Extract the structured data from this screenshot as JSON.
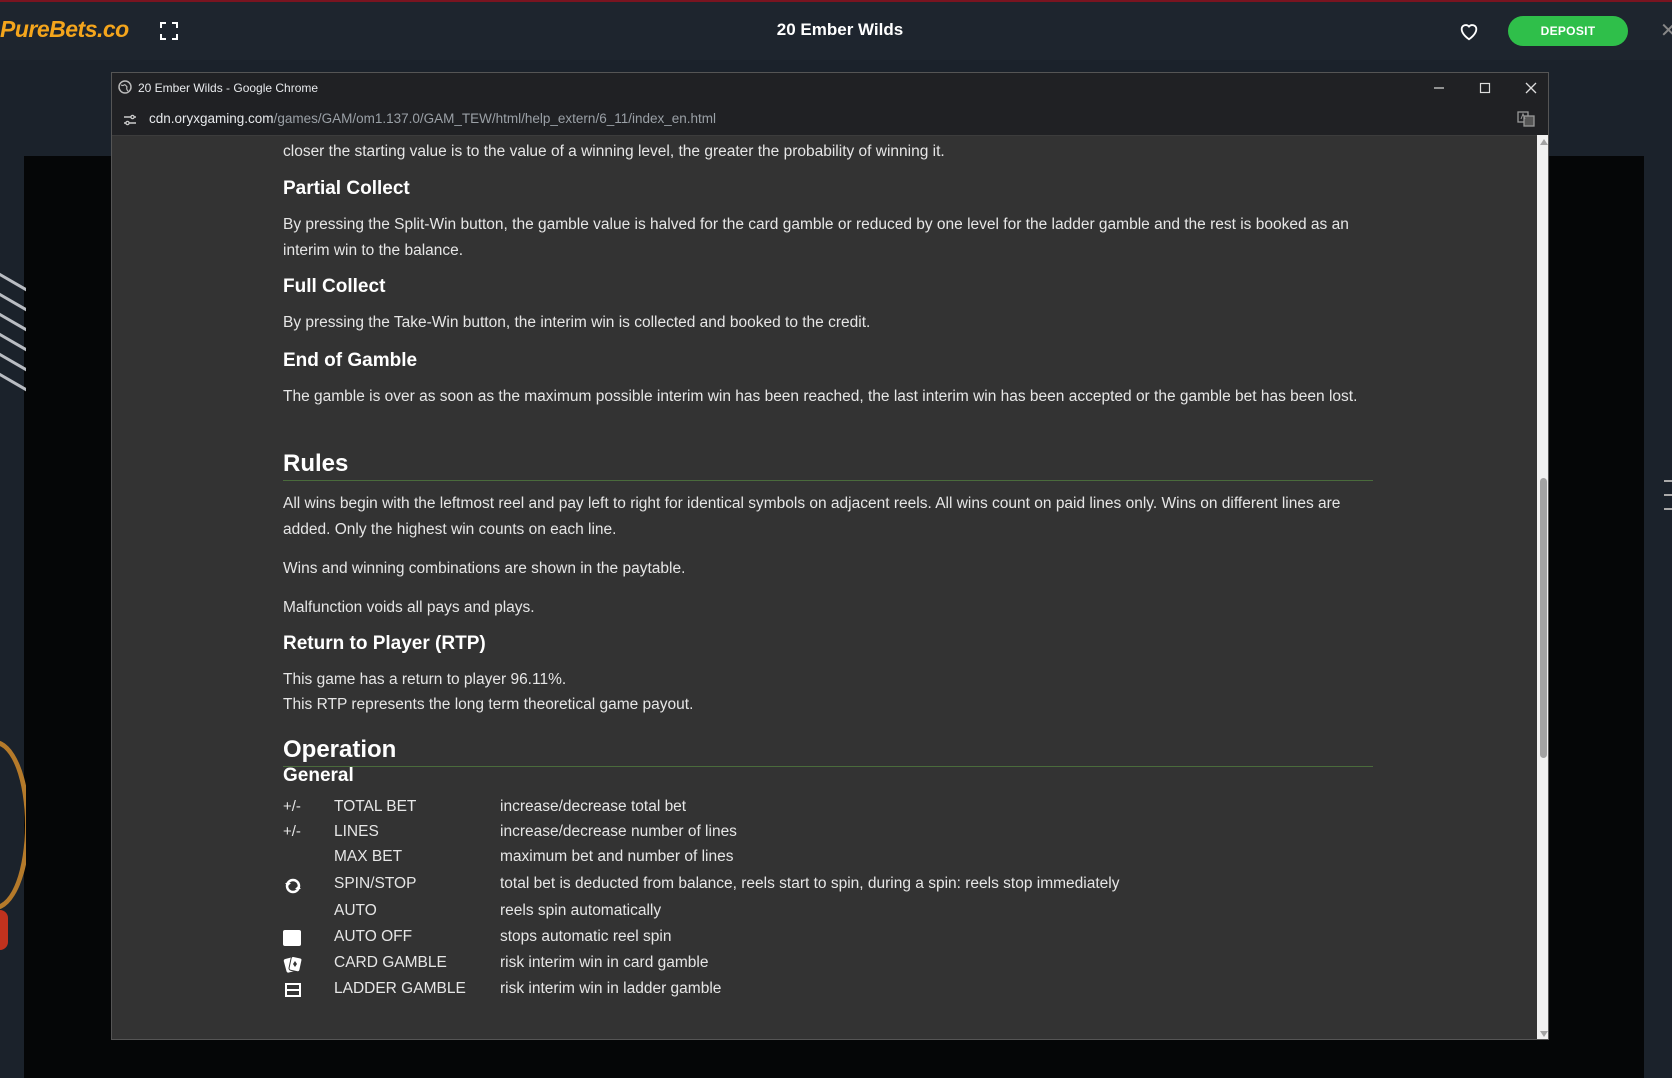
{
  "site": {
    "logo_main": "PureBets",
    "logo_tld": ".co",
    "game_title": "20 Ember Wilds",
    "deposit_label": "DEPOSIT"
  },
  "chrome": {
    "window_title": "20 Ember Wilds - Google Chrome",
    "url_host": "cdn.oryxgaming.com",
    "url_path": "/games/GAM/om1.137.0/GAM_TEW/html/help_extern/6_11/index_en.html"
  },
  "help": {
    "intro_tail": "closer the starting value is to the value of a winning level, the greater the probability of winning it.",
    "partial_collect": {
      "title": "Partial Collect",
      "text": "By pressing the Split-Win button, the gamble value is halved for the card gamble or reduced by one level for the ladder gamble and the rest is booked as an interim win to the balance."
    },
    "full_collect": {
      "title": "Full Collect",
      "text": "By pressing the Take-Win button, the interim win is collected and booked to the credit."
    },
    "end_of_gamble": {
      "title": "End of Gamble",
      "text": "The gamble is over as soon as the maximum possible interim win has been reached, the last interim win has been accepted or the gamble bet has been lost."
    },
    "rules": {
      "title": "Rules",
      "p1": "All wins begin with the leftmost reel and pay left to right for identical symbols on adjacent reels. All wins count on paid lines only. Wins on different lines are added. Only the highest win counts on each line.",
      "p2": "Wins and winning combinations are shown in the paytable.",
      "p3": "Malfunction voids all pays and plays."
    },
    "rtp": {
      "title": "Return to Player (RTP)",
      "line1": "This game has a return to player 96.11%.",
      "line2": "This RTP represents the long term theoretical game payout."
    },
    "operation": {
      "title": "Operation",
      "general_title": "General",
      "rows": [
        {
          "symbol": "+/-",
          "name": "TOTAL BET",
          "desc": "increase/decrease total bet"
        },
        {
          "symbol": "+/-",
          "name": "LINES",
          "desc": "increase/decrease number of lines"
        },
        {
          "symbol": "",
          "name": "MAX BET",
          "desc": "maximum bet and number of lines"
        },
        {
          "symbol": "",
          "name": "SPIN/STOP",
          "desc": "total bet is deducted from balance, reels start to spin, during a spin: reels stop immediately"
        },
        {
          "symbol": "",
          "name": "AUTO",
          "desc": "reels spin automatically"
        },
        {
          "symbol": "",
          "name": "AUTO OFF",
          "desc": "stops automatic reel spin"
        },
        {
          "symbol": "",
          "name": "CARD GAMBLE",
          "desc": "risk interim win in card gamble"
        },
        {
          "symbol": "",
          "name": "LADDER GAMBLE",
          "desc": "risk interim win in ladder gamble"
        }
      ]
    }
  }
}
